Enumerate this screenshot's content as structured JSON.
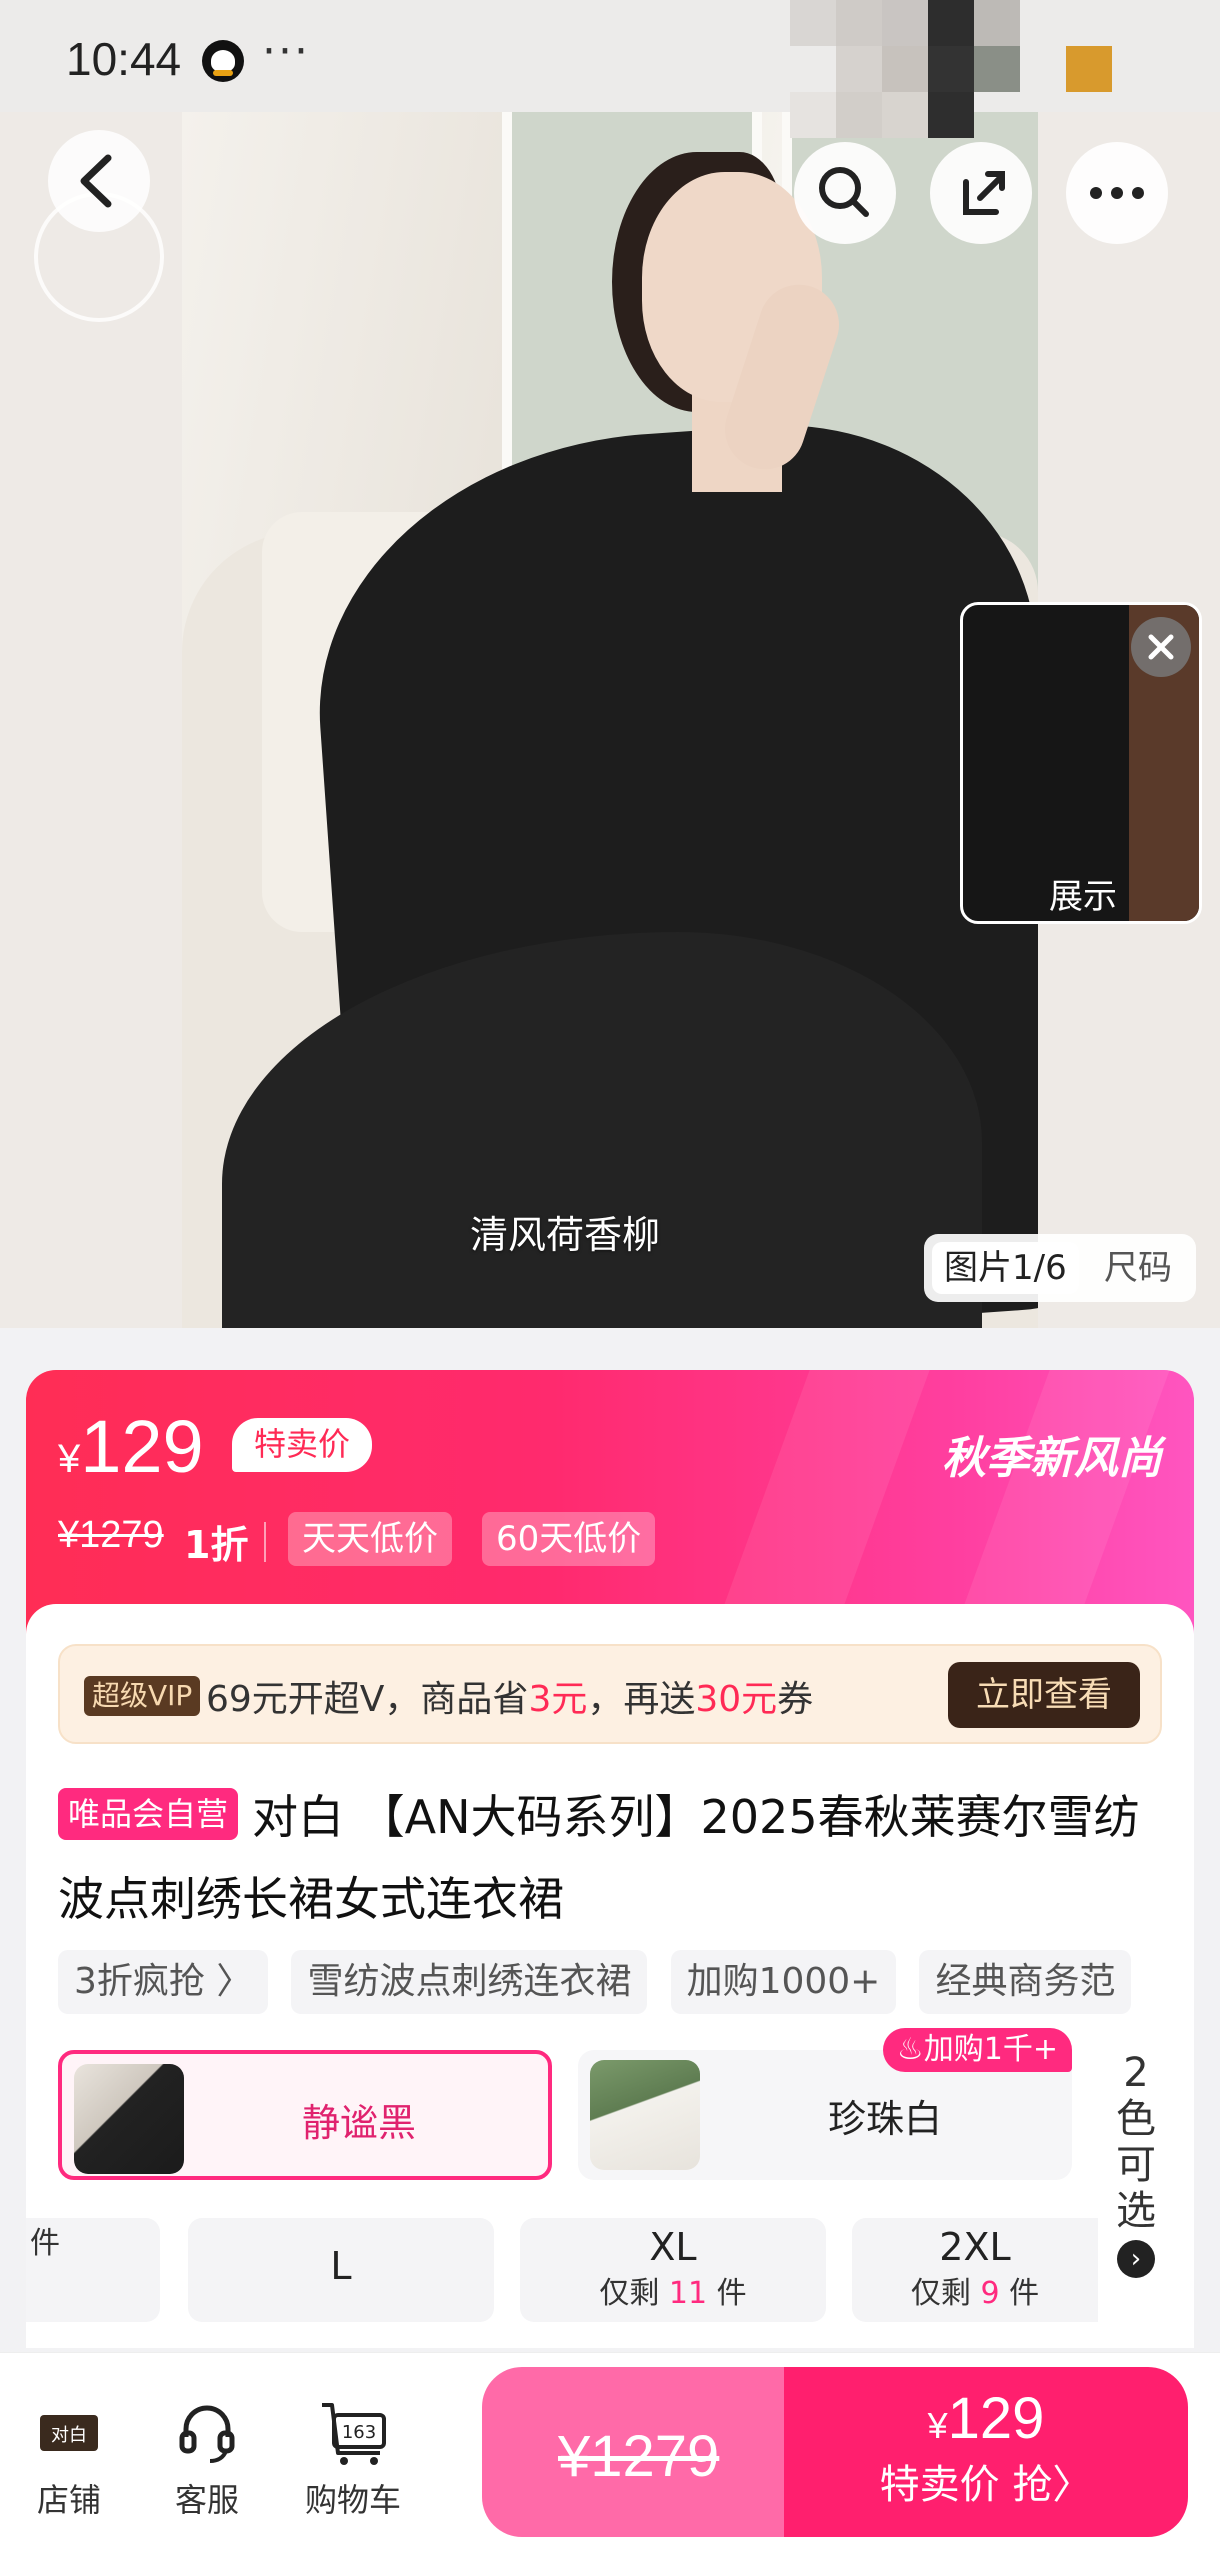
{
  "status": {
    "time": "10:44",
    "dots": "···"
  },
  "hero": {
    "caption": "清风荷香柳",
    "popup_label": "展示",
    "pager_current": "图片1/6",
    "pager_size": "尺码"
  },
  "price": {
    "currency": "¥",
    "current": "129",
    "tag": "特卖价",
    "campaign": "秋季新风尚",
    "original": "¥1279",
    "discount": "1折",
    "badges": [
      "天天低价",
      "60天低价"
    ]
  },
  "vip": {
    "badge": "超级VIP",
    "text_a": "69元开超Ⅴ，商品省",
    "amount_a": "3元",
    "text_b": "，再送",
    "amount_b": "30元",
    "text_c": "券",
    "button": "立即查看"
  },
  "product": {
    "seller_tag": "唯品会自营",
    "title": "对白 【AN大码系列】2025春秋莱赛尔雪纺波点刺绣长裙女式连衣裙",
    "chips": [
      "3折疯抢 〉",
      "雪纺波点刺绣连衣裙",
      "加购1000+",
      "经典商务范"
    ]
  },
  "colors": {
    "options": [
      {
        "label": "静谧黑",
        "selected": true
      },
      {
        "label": "珍珠白",
        "selected": false,
        "badge": "加购1千+"
      }
    ],
    "more": [
      "2",
      "色",
      "可",
      "选"
    ],
    "more_arrow": "›"
  },
  "sizes": [
    {
      "name": "",
      "stock_prefix": "",
      "stock_n": "",
      "stock_suffix": "件"
    },
    {
      "name": "L",
      "stock_prefix": "",
      "stock_n": "",
      "stock_suffix": ""
    },
    {
      "name": "XL",
      "stock_prefix": "仅剩 ",
      "stock_n": "11",
      "stock_suffix": " 件"
    },
    {
      "name": "2XL",
      "stock_prefix": "仅剩 ",
      "stock_n": "9",
      "stock_suffix": " 件"
    }
  ],
  "bottom": {
    "shop": "店铺",
    "service": "客服",
    "cart": "购物车",
    "cart_count": "163",
    "shop_logo": "对白",
    "orig_price": "¥1279",
    "buy_currency": "¥",
    "buy_price": "129",
    "buy_label": "特卖价 抢〉"
  },
  "colors_theme": {
    "accent": "#ff2a7f",
    "price_red": "#ff2d55",
    "vip_dark": "#3a2418"
  }
}
